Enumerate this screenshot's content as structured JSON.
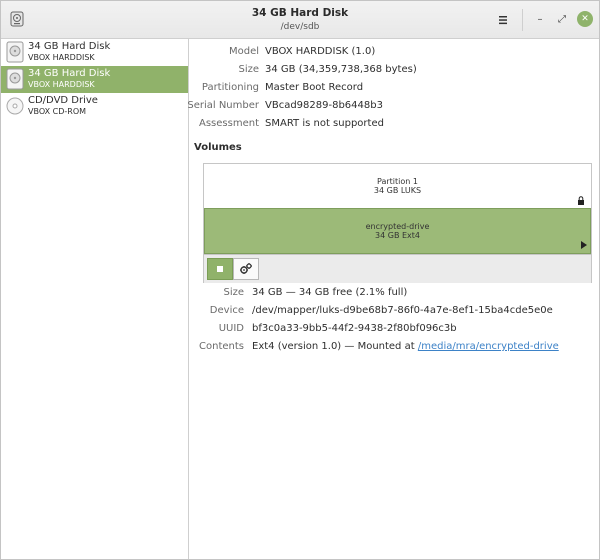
{
  "header": {
    "title": "34 GB Hard Disk",
    "subtitle": "/dev/sdb",
    "menu_icon": "hamburger-menu-icon",
    "minimize_glyph": "–",
    "maximize_glyph": "⤢",
    "close_glyph": "✕"
  },
  "sidebar": {
    "drives": [
      {
        "name": "34 GB Hard Disk",
        "sub": "VBOX HARDDISK",
        "icon": "hard-disk-icon"
      },
      {
        "name": "34 GB Hard Disk",
        "sub": "VBOX HARDDISK",
        "icon": "hard-disk-icon"
      },
      {
        "name": "CD/DVD Drive",
        "sub": "VBOX CD-ROM",
        "icon": "optical-disc-icon"
      }
    ]
  },
  "disk_info": {
    "model_label": "Model",
    "model": "VBOX HARDDISK (1.0)",
    "size_label": "Size",
    "size": "34 GB (34,359,738,368 bytes)",
    "partitioning_label": "Partitioning",
    "partitioning": "Master Boot Record",
    "serial_label": "Serial Number",
    "serial": "VBcad98289-8b6448b3",
    "assessment_label": "Assessment",
    "assessment": "SMART is not supported"
  },
  "volumes": {
    "title": "Volumes",
    "partition": {
      "name": "Partition 1",
      "sub": "34 GB LUKS"
    },
    "encrypted": {
      "name": "encrypted-drive",
      "sub": "34 GB Ext4"
    }
  },
  "volume_info": {
    "size_label": "Size",
    "size": "34 GB — 34 GB free (2.1% full)",
    "device_label": "Device",
    "device": "/dev/mapper/luks-d9be68b7-86f0-4a7e-8ef1-15ba4cde5e0e",
    "uuid_label": "UUID",
    "uuid": "bf3c0a33-9bb5-44f2-9438-2f80bf096c3b",
    "contents_label": "Contents",
    "contents_prefix": "Ext4 (version 1.0) — Mounted at ",
    "mount_link": "/media/mra/encrypted-drive"
  },
  "colors": {
    "accent": "#90b26a",
    "link": "#3d82c7"
  }
}
